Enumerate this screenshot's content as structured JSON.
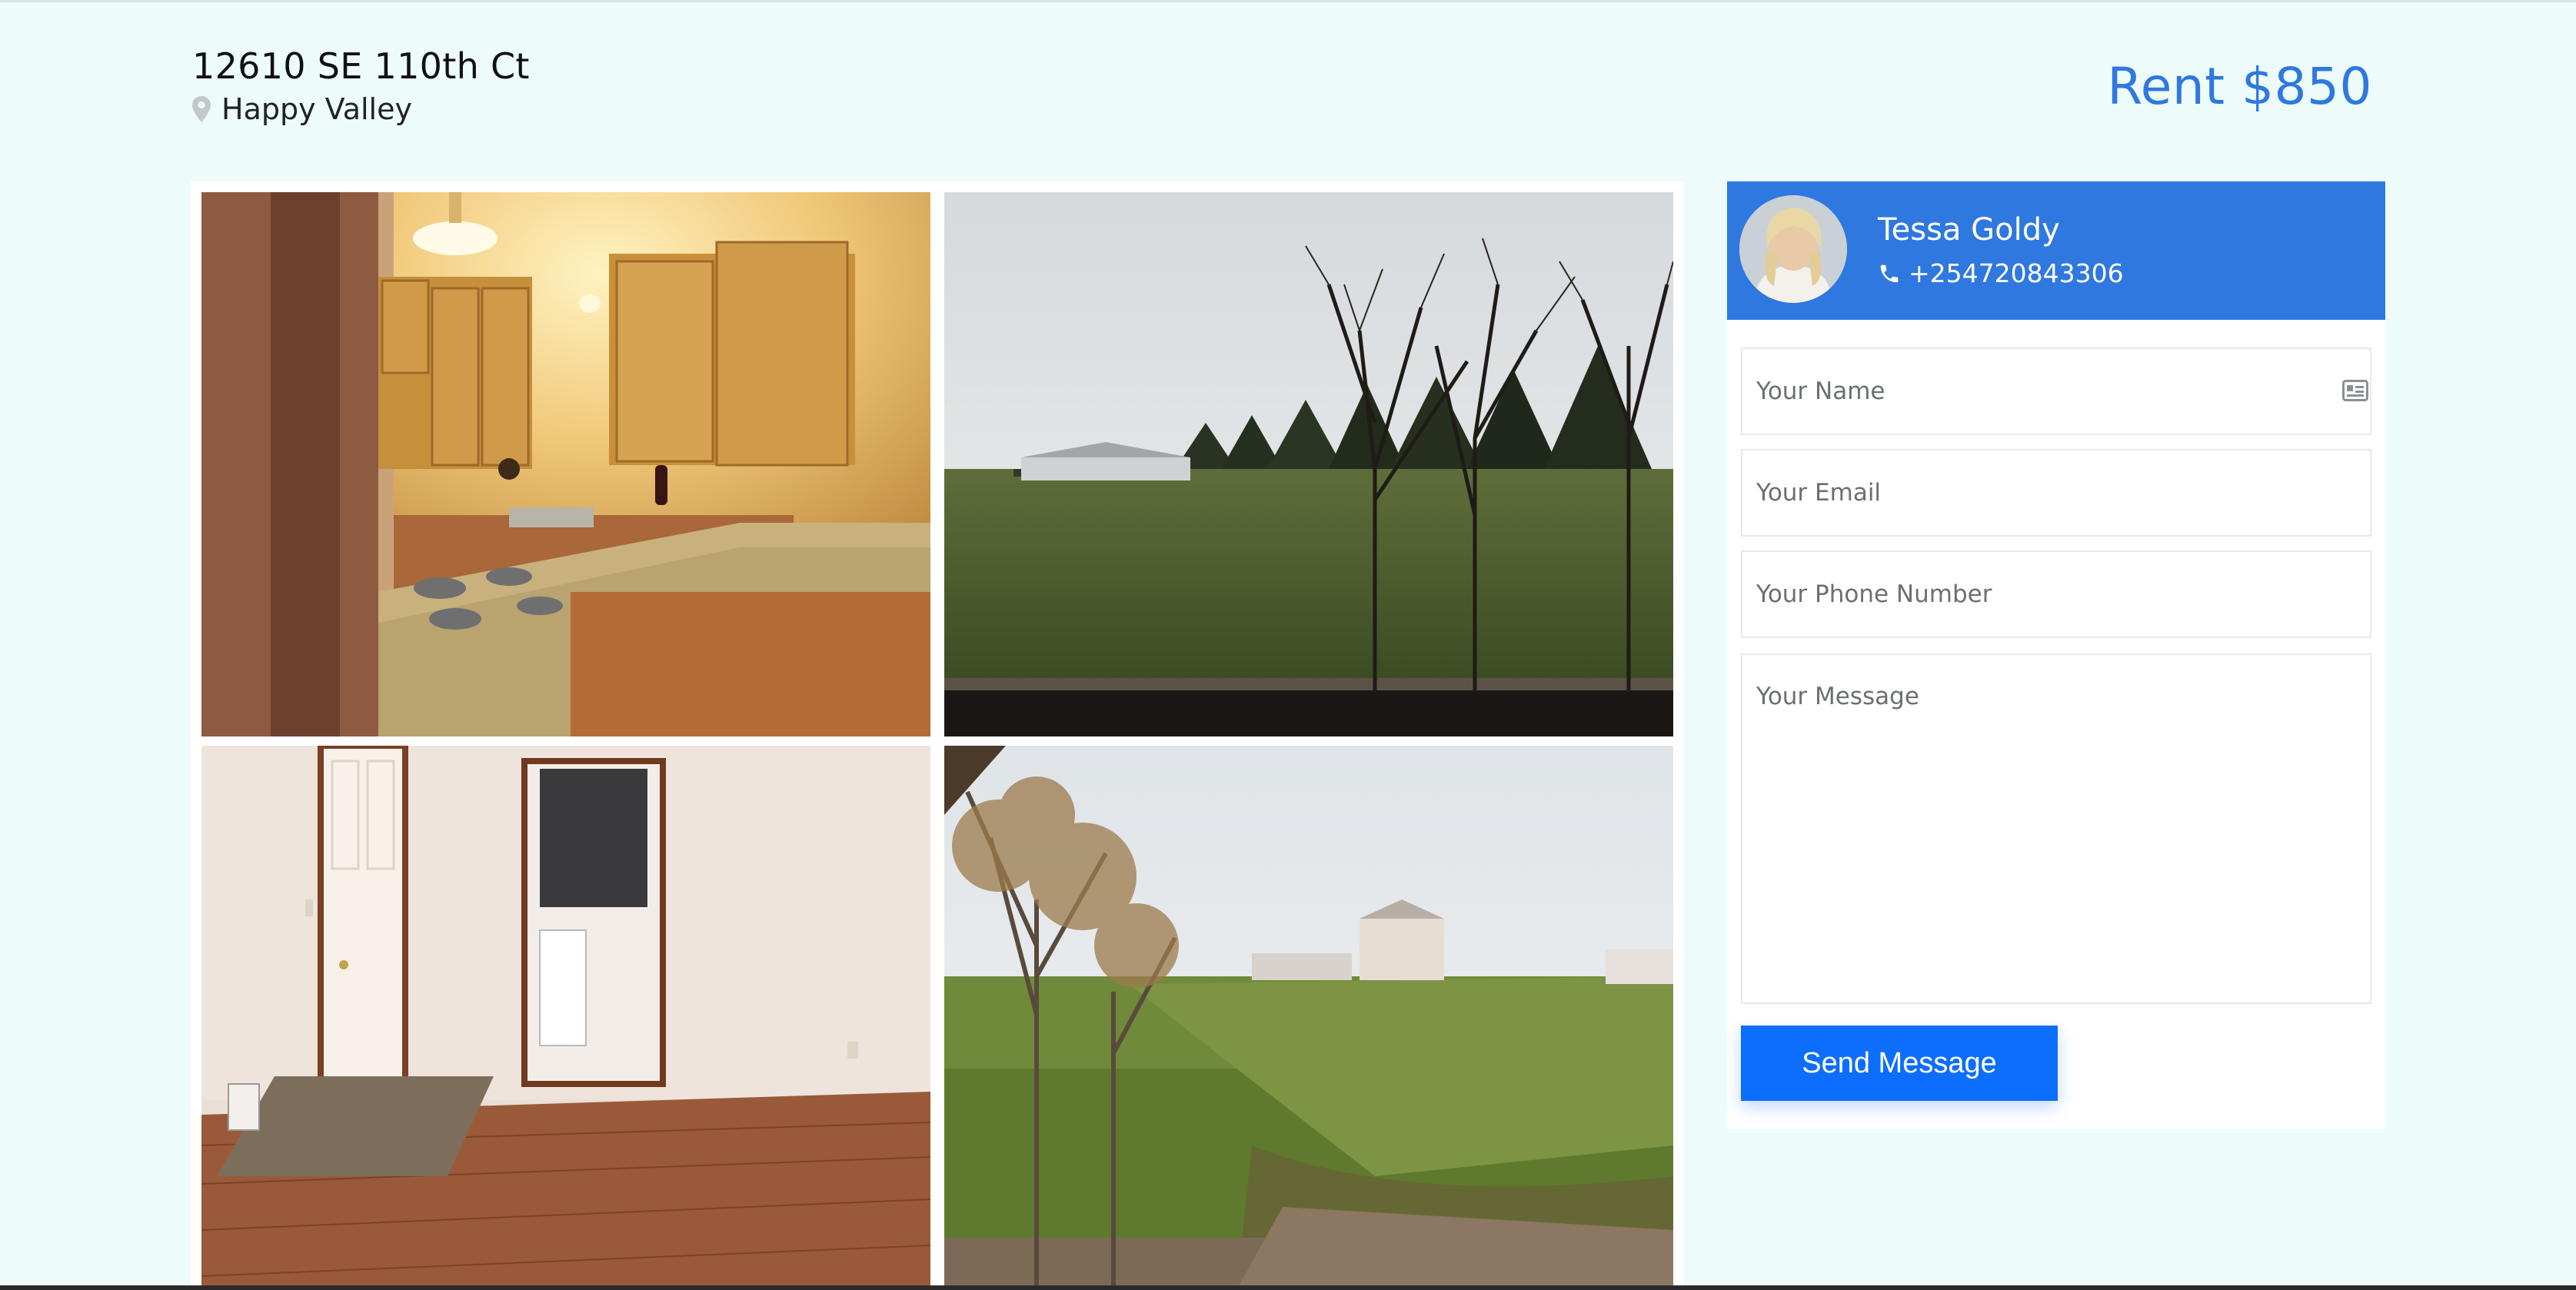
{
  "listing": {
    "address": "12610 SE 110th Ct",
    "city": "Happy Valley",
    "price": "Rent $850"
  },
  "gallery": {
    "photos": [
      {
        "subject": "kitchen"
      },
      {
        "subject": "backyard-trees"
      },
      {
        "subject": "living-room"
      },
      {
        "subject": "field-view"
      }
    ]
  },
  "agent": {
    "name": "Tessa Goldy",
    "phone": "+254720843306"
  },
  "contact_form": {
    "name_placeholder": "Your Name",
    "email_placeholder": "Your Email",
    "phone_placeholder": "Your Phone Number",
    "message_placeholder": "Your Message",
    "submit_label": "Send Message"
  },
  "colors": {
    "accent": "#2f78e0",
    "button": "#0d6efd",
    "background": "#eefbfb"
  },
  "icons": {
    "location": "map-pin-icon",
    "phone": "phone-icon",
    "name_field": "id-card-icon"
  }
}
